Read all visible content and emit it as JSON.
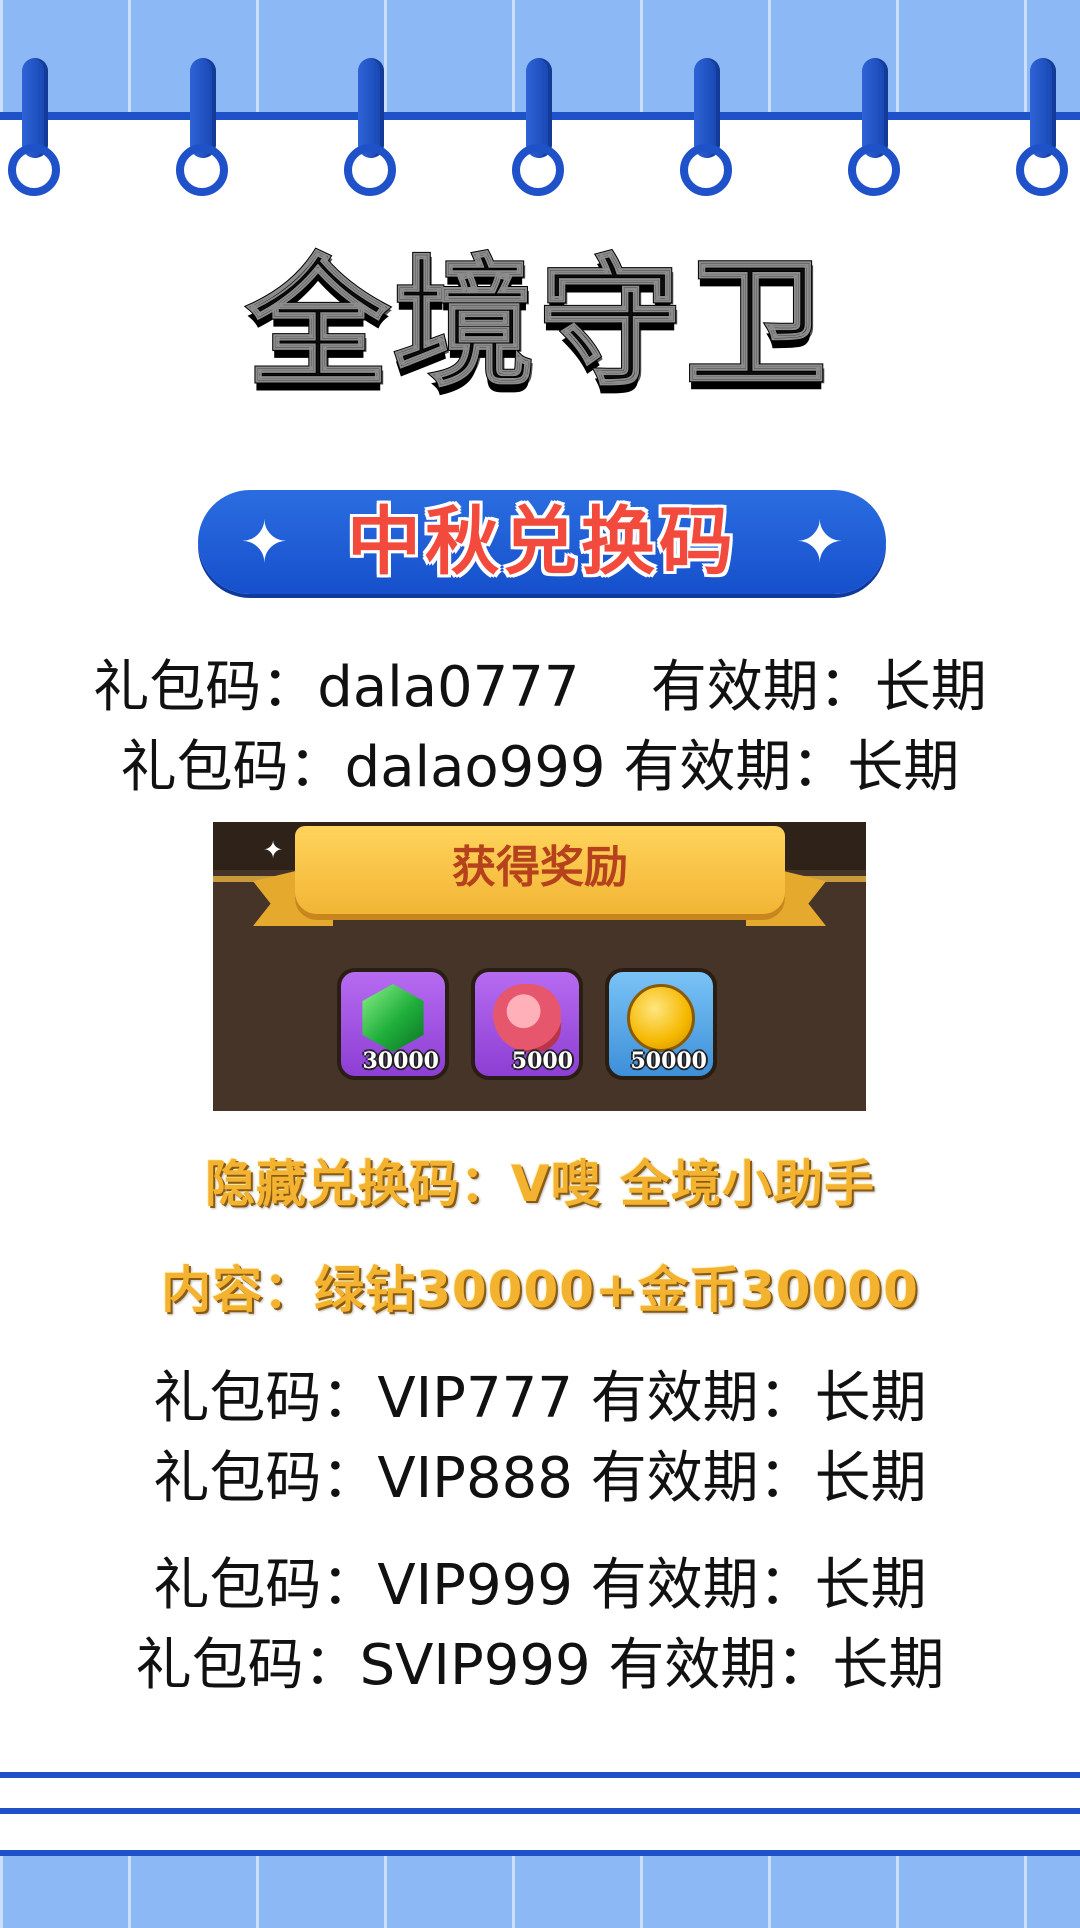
{
  "title": "全境守卫",
  "banner": {
    "label": "中秋兑换码",
    "sparkle_icon": "sparkle-icon"
  },
  "codes_top": [
    "礼包码：dala0777    有效期：长期",
    "礼包码：dalao999 有效期：长期"
  ],
  "reward_panel": {
    "heading": "获得奖励",
    "items": [
      {
        "icon": "green-gem-icon",
        "count": "30000"
      },
      {
        "icon": "meat-icon",
        "count": "5000"
      },
      {
        "icon": "gold-crown-coin-icon",
        "count": "50000"
      }
    ]
  },
  "hidden_code": {
    "line1": "隐藏兑换码：V嗖 全境小助手",
    "line2": "内容：绿钻30000+金币30000"
  },
  "codes_bottom": [
    "礼包码：VIP777 有效期：长期",
    "礼包码：VIP888 有效期：长期",
    "礼包码：VIP999 有效期：长期",
    "礼包码：SVIP999 有效期：长期"
  ],
  "colors": {
    "accent_blue": "#1f52c8",
    "band_blue": "#8cb8f5",
    "banner_red": "#f24a3c",
    "gold": "#f3b230"
  }
}
